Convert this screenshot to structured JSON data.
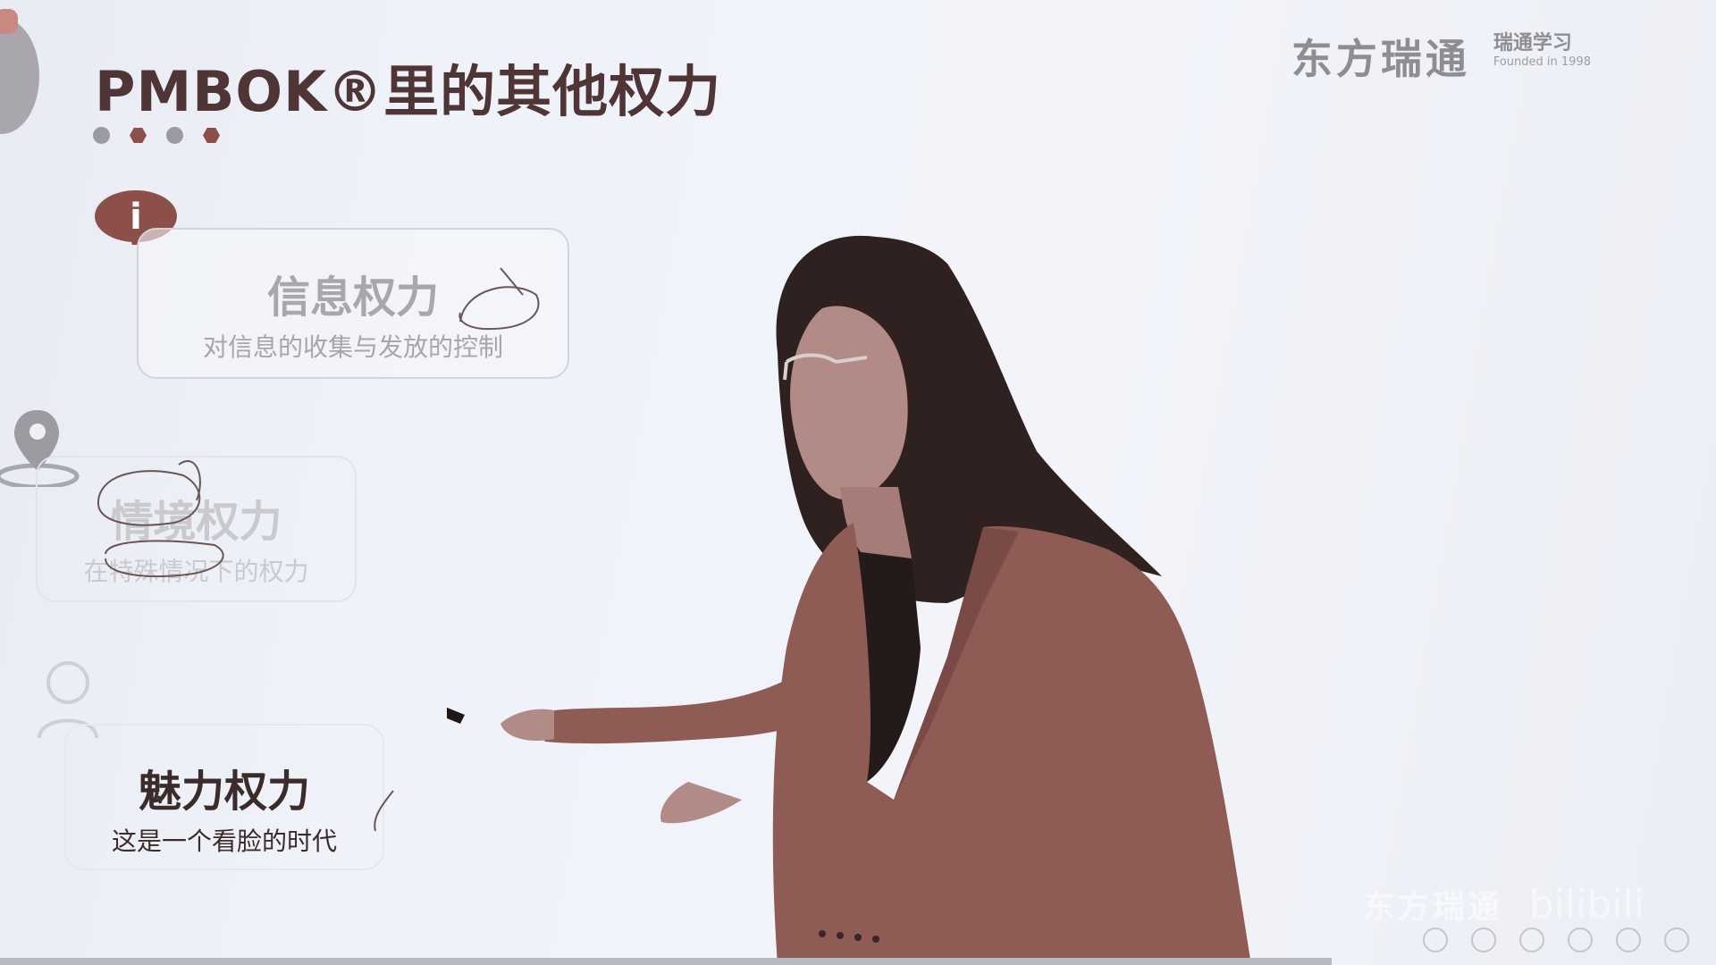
{
  "slide": {
    "title": "PMBOK®里的其他权力",
    "brand": {
      "name": "东方瑞通",
      "sub1": "瑞通学习",
      "sub2": "Founded in 1998"
    },
    "cards": [
      {
        "title": "信息权力",
        "desc": "对信息的收集与发放的控制"
      },
      {
        "title": "情境权力",
        "desc": "在特殊情况下的权力"
      },
      {
        "title": "魅力权力",
        "desc": "这是一个看脸的时代"
      }
    ],
    "info_glyph": "i"
  },
  "watermark": {
    "brand": "东方瑞通",
    "site": "bilibili"
  },
  "colors": {
    "accent": "#8c4f4a",
    "title": "#4f3535",
    "jacket": "#8e5b55"
  }
}
